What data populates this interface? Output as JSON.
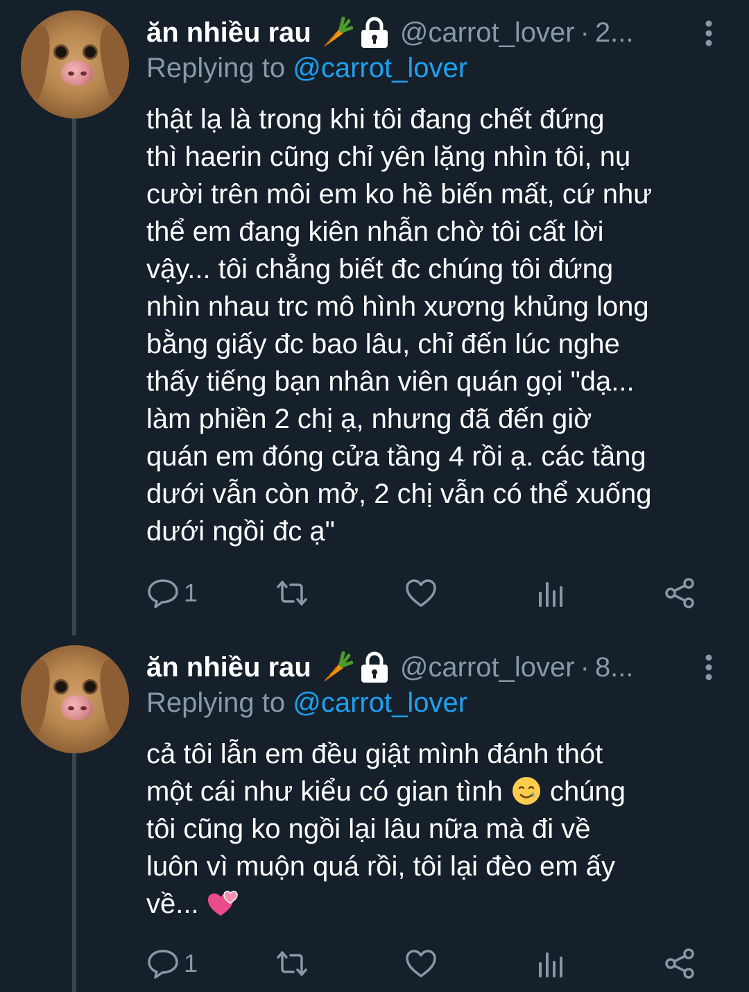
{
  "tweets": [
    {
      "author_name": "ăn nhiều rau",
      "handle": "@carrot_lover",
      "separator": "·",
      "timestamp": "2...",
      "replying_prefix": "Replying to",
      "replying_to": "@carrot_lover",
      "text": "thật lạ là trong khi tôi đang chết đứng\nthì haerin cũng chỉ yên lặng nhìn tôi, nụ\ncười trên môi em ko hề biến mất, cứ như\nthể em đang kiên nhẫn chờ tôi cất lời\nvậy... tôi chẳng biết đc chúng tôi đứng\nnhìn nhau trc mô hình xương khủng long\nbằng giấy đc bao lâu, chỉ đến lúc nghe\nthấy tiếng bạn nhân viên quán gọi \"dạ...\nlàm phiền 2 chị ạ, nhưng đã đến giờ\nquán em đóng cửa tầng 4 rồi ạ. các tầng\ndưới vẫn còn mở, 2 chị vẫn có thể xuống\ndưới ngồi đc ạ\"",
      "reply_count": "1"
    },
    {
      "author_name": "ăn nhiều rau",
      "handle": "@carrot_lover",
      "separator": "·",
      "timestamp": "8...",
      "replying_prefix": "Replying to",
      "replying_to": "@carrot_lover",
      "text_lines": [
        "cả tôi lẫn em đều giật mình đánh thót",
        "một cái như kiểu có gian tình",
        "chúng",
        "tôi cũng ko ngồi lại lâu nữa mà đi về",
        "luôn vì muộn quá rồi, tôi lại đèo em ấy",
        "về..."
      ],
      "reply_count": "1"
    }
  ],
  "icons": {
    "name_emoji_1": "carrot-icon",
    "name_emoji_2": "lock-icon",
    "inline_emoji_1": "smiling-face-with-tear-icon",
    "inline_emoji_2": "two-hearts-icon",
    "actions": [
      "reply-icon",
      "retweet-icon",
      "like-icon",
      "analytics-icon",
      "share-icon"
    ]
  },
  "colors": {
    "background": "#15202b",
    "secondary_text": "#8899a6",
    "mention": "#1da1f2",
    "thread_line": "#38444d"
  }
}
